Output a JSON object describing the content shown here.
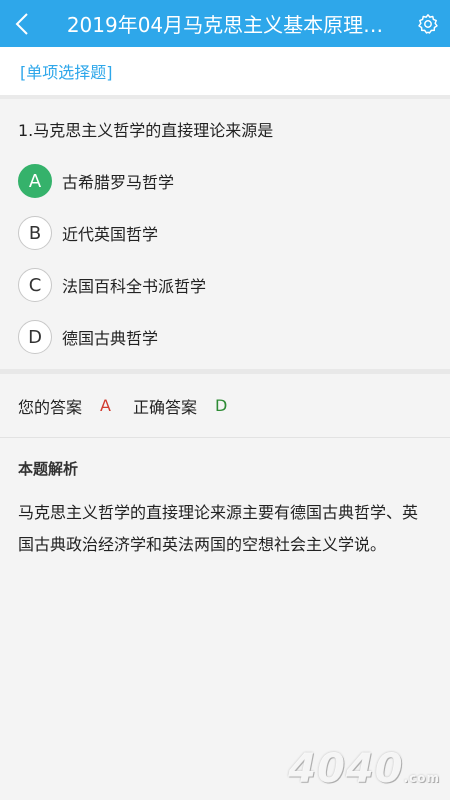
{
  "header": {
    "title": "2019年04月马克思主义基本原理…",
    "back_icon": "back-arrow-icon",
    "settings_icon": "gear-icon",
    "bg_color": "#2ea7ea"
  },
  "question_type": "[单项选择题]",
  "question": {
    "text": "1.马克思主义哲学的直接理论来源是",
    "options": [
      {
        "letter": "A",
        "text": "古希腊罗马哲学",
        "selected": true
      },
      {
        "letter": "B",
        "text": "近代英国哲学",
        "selected": false
      },
      {
        "letter": "C",
        "text": "法国百科全书派哲学",
        "selected": false
      },
      {
        "letter": "D",
        "text": "德国古典哲学",
        "selected": false
      }
    ]
  },
  "answer": {
    "your_label": "您的答案",
    "your_value": "A",
    "correct_label": "正确答案",
    "correct_value": "D"
  },
  "analysis": {
    "title": "本题解析",
    "text": "马克思主义哲学的直接理论来源主要有德国古典哲学、英国古典政治经济学和英法两国的空想社会主义学说。"
  },
  "watermark": {
    "main": "4040",
    "suffix": ".com"
  }
}
